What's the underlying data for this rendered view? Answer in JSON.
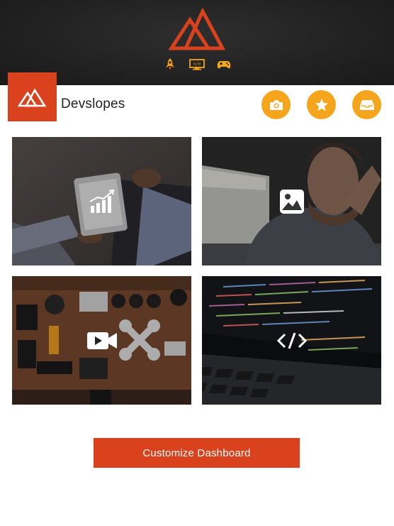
{
  "header": {
    "logo_icon": "mountain-logo-icon",
    "icons": [
      "rocket-icon",
      "monitor-code-icon",
      "gamepad-icon"
    ]
  },
  "profile": {
    "name": "Devslopes",
    "logo_icon": "mountain-logo-icon"
  },
  "actions": [
    "camera-icon",
    "star-icon",
    "inbox-icon"
  ],
  "tiles": [
    {
      "icon": "analytics-tablet-icon",
      "scene": "business meeting with tablet chart"
    },
    {
      "icon": "image-icon",
      "scene": "man looking at window"
    },
    {
      "icon": "video-camera-icon",
      "scene": "camera gear and drone flat lay"
    },
    {
      "icon": "code-icon",
      "scene": "laptop with code"
    }
  ],
  "cta": {
    "label": "Customize Dashboard"
  },
  "colors": {
    "brand": "#d9421c",
    "accent": "#f5a51b",
    "header_bg": "#222222"
  }
}
